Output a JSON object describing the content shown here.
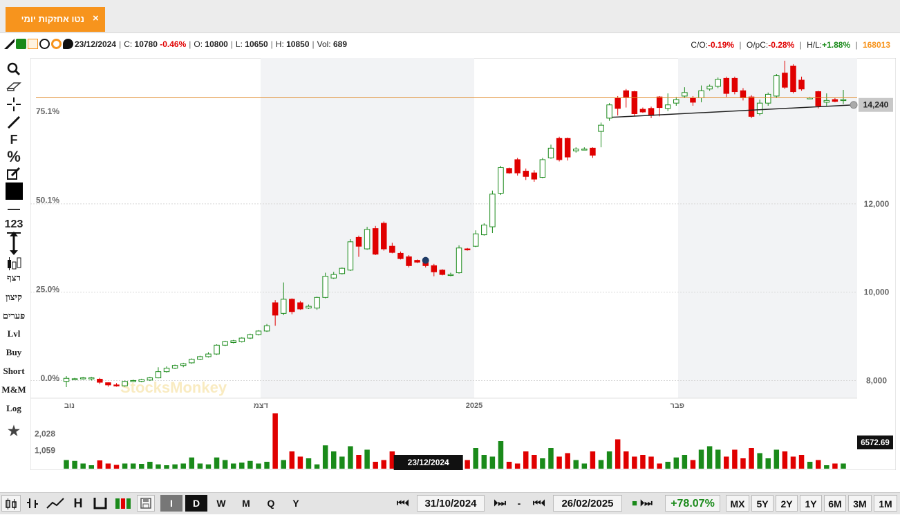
{
  "tab": {
    "title": "נטו אחזקות יומי",
    "close": "×"
  },
  "info": {
    "date": "23/12/2024",
    "close_label": "C:",
    "close_value": "10780",
    "change_pct": "-0.46%",
    "open_label": "O:",
    "open_value": "10800",
    "low_label": "L:",
    "low_value": "10650",
    "high_label": "H:",
    "high_value": "10850",
    "vol_label": "Vol:",
    "vol_value": "689",
    "co_label": "C/O:",
    "co_value": "-0.19%",
    "opc_label": "O/pC:",
    "opc_value": "-0.28%",
    "hl_label": "H/L:",
    "hl_value": "+1.88%",
    "code": "168013"
  },
  "tools": {
    "f": "F",
    "percent": "%",
    "num": "123",
    "ritzef": "רצף",
    "kitzun": "קיצון",
    "paarim": "פערים",
    "lvl": "Lvl",
    "buy": "Buy",
    "short": "Short",
    "mm": "M&M",
    "log": "Log"
  },
  "colors": {
    "up": "#1a8a1a",
    "down": "#e00000",
    "accent": "#f7941d",
    "tab": "#f7941d"
  },
  "chart_data": {
    "type": "candlestick",
    "price_axis": {
      "ticks": [
        "8,000",
        "10,000",
        "12,000"
      ],
      "min": 7600,
      "max": 15300,
      "current_label": "14,240"
    },
    "percent_axis": {
      "ticks": [
        "0.0%",
        "25.0%",
        "50.1%",
        "75.1%"
      ]
    },
    "x_labels": [
      "נוב",
      "דצמ",
      "2025",
      "פבר"
    ],
    "horizontal_line": 14400,
    "trendline": {
      "from": 13960,
      "to": 14240
    },
    "marker_price": 10720,
    "crosshair_date": "23/12/2024",
    "watermark": "StocksMonkey",
    "volume_axis": {
      "ticks": [
        "1,059",
        "2,028"
      ],
      "max": 3200,
      "current_label": "6572.69"
    },
    "candles": [
      [
        7980,
        8050,
        7850,
        8100,
        500
      ],
      [
        8020,
        8040,
        8010,
        8060,
        450
      ],
      [
        8040,
        8060,
        8020,
        8080,
        300
      ],
      [
        8040,
        8060,
        8000,
        8080,
        200
      ],
      [
        8030,
        7960,
        7920,
        8060,
        480
      ],
      [
        7950,
        7900,
        7860,
        7960,
        300
      ],
      [
        7900,
        7880,
        7860,
        7940,
        220
      ],
      [
        7880,
        7980,
        7860,
        8000,
        300
      ],
      [
        7980,
        8000,
        7970,
        8020,
        300
      ],
      [
        7980,
        8020,
        7960,
        8040,
        280
      ],
      [
        8010,
        8060,
        7990,
        8080,
        400
      ],
      [
        8060,
        8200,
        8050,
        8300,
        250
      ],
      [
        8200,
        8280,
        8180,
        8320,
        200
      ],
      [
        8280,
        8340,
        8260,
        8360,
        250
      ],
      [
        8340,
        8380,
        8300,
        8400,
        300
      ],
      [
        8400,
        8480,
        8380,
        8500,
        650
      ],
      [
        8480,
        8540,
        8460,
        8560,
        300
      ],
      [
        8540,
        8600,
        8520,
        8640,
        250
      ],
      [
        8600,
        8800,
        8580,
        8820,
        650
      ],
      [
        8800,
        8880,
        8780,
        8900,
        500
      ],
      [
        8860,
        8900,
        8840,
        8920,
        300
      ],
      [
        8880,
        8960,
        8860,
        8980,
        350
      ],
      [
        8960,
        9040,
        8940,
        9060,
        450
      ],
      [
        9040,
        9120,
        9020,
        9140,
        300
      ],
      [
        9120,
        9240,
        9100,
        9280,
        400
      ],
      [
        9760,
        9480,
        9240,
        9820,
        3200
      ],
      [
        9520,
        9840,
        9480,
        10220,
        500
      ],
      [
        9840,
        9560,
        9500,
        9860,
        1000
      ],
      [
        9760,
        9620,
        9600,
        9800,
        700
      ],
      [
        9640,
        9680,
        9620,
        9720,
        600
      ],
      [
        9640,
        9880,
        9600,
        9900,
        250
      ],
      [
        9880,
        10360,
        9860,
        10440,
        1350
      ],
      [
        10320,
        10400,
        10300,
        10460,
        1000
      ],
      [
        10420,
        10540,
        10400,
        10560,
        700
      ],
      [
        10500,
        11140,
        10480,
        11200,
        1300
      ],
      [
        11240,
        11040,
        10800,
        11280,
        800
      ],
      [
        10980,
        11420,
        10960,
        11480,
        1100
      ],
      [
        11440,
        10860,
        10840,
        11500,
        400
      ],
      [
        11560,
        10980,
        10940,
        11600,
        500
      ],
      [
        11040,
        10900,
        10880,
        11120,
        1000
      ],
      [
        10880,
        10760,
        10740,
        10920,
        800
      ],
      [
        10800,
        10600,
        10560,
        10840,
        700
      ],
      [
        10720,
        10680,
        10660,
        10740,
        600
      ],
      [
        10700,
        10600,
        10560,
        10720,
        689
      ],
      [
        10600,
        10460,
        10360,
        10640,
        600
      ],
      [
        10500,
        10400,
        10380,
        10520,
        400
      ],
      [
        10380,
        10400,
        10360,
        10440,
        150
      ],
      [
        10440,
        11000,
        10420,
        11060,
        250
      ],
      [
        10980,
        10960,
        10940,
        11000,
        500
      ],
      [
        11040,
        11320,
        11020,
        11400,
        1200
      ],
      [
        11300,
        11520,
        11280,
        11560,
        800
      ],
      [
        11480,
        12220,
        11340,
        12300,
        700
      ],
      [
        12240,
        12820,
        12200,
        12860,
        1600
      ],
      [
        12800,
        12700,
        12680,
        12820,
        400
      ],
      [
        13000,
        12700,
        12640,
        13040,
        300
      ],
      [
        12740,
        12620,
        12540,
        12800,
        1000
      ],
      [
        12700,
        12560,
        12500,
        12760,
        800
      ],
      [
        12600,
        13000,
        12580,
        13040,
        600
      ],
      [
        13040,
        13260,
        13020,
        13340,
        1200
      ],
      [
        13480,
        13000,
        12960,
        13520,
        700
      ],
      [
        13480,
        13060,
        12980,
        13500,
        900
      ],
      [
        13200,
        13240,
        13160,
        13280,
        500
      ],
      [
        13240,
        13240,
        13220,
        13280,
        300
      ],
      [
        13260,
        13100,
        13040,
        13280,
        1000
      ],
      [
        13640,
        13780,
        13280,
        13840,
        500
      ],
      [
        13940,
        14240,
        13880,
        14280,
        1000
      ],
      [
        14400,
        14160,
        14000,
        14440,
        1700
      ],
      [
        14560,
        14420,
        14180,
        14600,
        1000
      ],
      [
        14540,
        14040,
        13980,
        14560,
        700
      ],
      [
        14140,
        14080,
        14060,
        14180,
        800
      ],
      [
        14160,
        14000,
        13940,
        14200,
        700
      ],
      [
        14420,
        14180,
        13980,
        14440,
        300
      ],
      [
        14160,
        14240,
        14100,
        14500,
        400
      ],
      [
        14280,
        14360,
        14220,
        14420,
        650
      ],
      [
        14440,
        14520,
        14400,
        14640,
        800
      ],
      [
        14400,
        14300,
        14220,
        14440,
        500
      ],
      [
        14400,
        14560,
        14300,
        14680,
        1100
      ],
      [
        14600,
        14660,
        14560,
        14700,
        1300
      ],
      [
        14660,
        14820,
        14620,
        14860,
        1100
      ],
      [
        14840,
        14500,
        14420,
        14880,
        700
      ],
      [
        14840,
        14540,
        14480,
        14880,
        1100
      ],
      [
        14560,
        14400,
        14340,
        14620,
        600
      ],
      [
        14420,
        13980,
        13940,
        14460,
        1200
      ],
      [
        14040,
        14280,
        14000,
        14360,
        900
      ],
      [
        14280,
        14480,
        14220,
        14520,
        600
      ],
      [
        14440,
        14900,
        14400,
        14940,
        1100
      ],
      [
        14960,
        14640,
        14600,
        15240,
        1000
      ],
      [
        15120,
        14540,
        14500,
        15160,
        700
      ],
      [
        14800,
        14600,
        14560,
        14880,
        800
      ],
      [
        14400,
        14400,
        14380,
        14420,
        400
      ],
      [
        14540,
        14220,
        14160,
        14560,
        500
      ],
      [
        14300,
        14340,
        14200,
        14500,
        200
      ],
      [
        14360,
        14320,
        14300,
        14400,
        300
      ],
      [
        14340,
        14360,
        14260,
        14580,
        300
      ]
    ]
  },
  "bottom": {
    "btn_i": "I",
    "btn_d": "D",
    "btn_w": "W",
    "btn_m": "M",
    "btn_q": "Q",
    "btn_y": "Y",
    "start_date": "31/10/2024",
    "dash": "-",
    "end_date": "26/02/2025",
    "change": "+78.07%",
    "ranges": [
      "MX",
      "5Y",
      "2Y",
      "1Y",
      "6M",
      "3M",
      "1M"
    ]
  }
}
